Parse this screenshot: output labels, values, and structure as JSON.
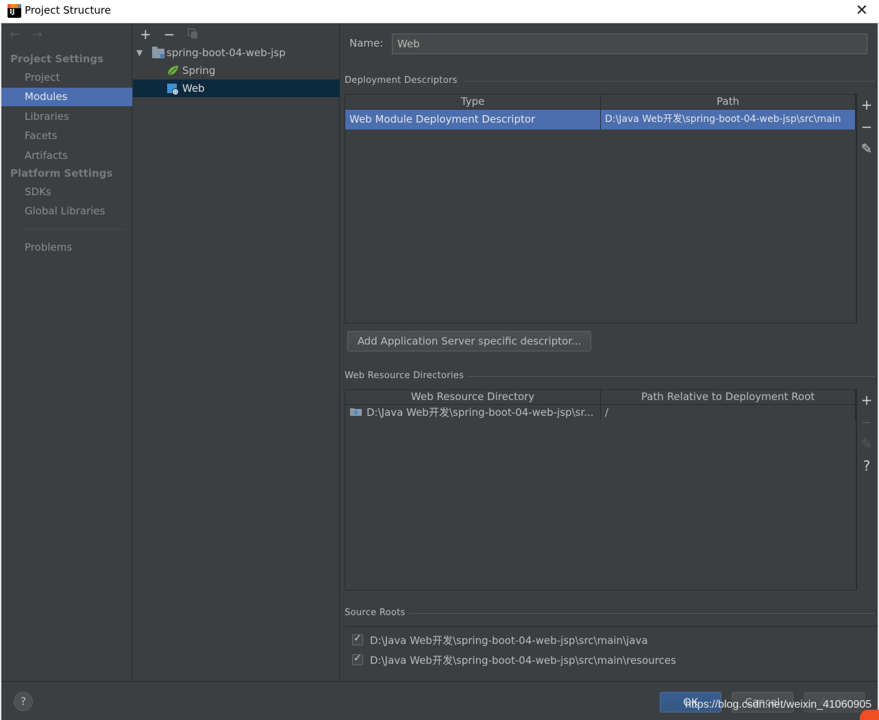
{
  "window": {
    "title": "Project Structure",
    "close_glyph": "✕"
  },
  "sidebar": {
    "nav_back": "←",
    "nav_forward": "→",
    "project_settings_header": "Project Settings",
    "project_items": [
      {
        "label": "Project"
      },
      {
        "label": "Modules",
        "active": true
      },
      {
        "label": "Libraries"
      },
      {
        "label": "Facets"
      },
      {
        "label": "Artifacts"
      }
    ],
    "platform_settings_header": "Platform Settings",
    "platform_items": [
      {
        "label": "SDKs"
      },
      {
        "label": "Global Libraries"
      }
    ],
    "problems_label": "Problems"
  },
  "tree": {
    "toolbar": {
      "add": "+",
      "remove": "−"
    },
    "root": {
      "label": "spring-boot-04-web-jsp",
      "expand_glyph": "▼",
      "icon": "module-folder-icon"
    },
    "children": [
      {
        "label": "Spring",
        "icon": "spring-leaf-icon"
      },
      {
        "label": "Web",
        "icon": "web-facet-icon",
        "selected": true
      }
    ]
  },
  "details": {
    "name_label": "Name:",
    "name_value": "Web",
    "deployment_descriptors": {
      "section_title": "Deployment Descriptors",
      "columns": [
        "Type",
        "Path"
      ],
      "rows": [
        {
          "type": "Web Module Deployment Descriptor",
          "path": "D:\\Java Web开发\\spring-boot-04-web-jsp\\src\\main",
          "selected": true
        }
      ],
      "tools": {
        "add": "+",
        "remove": "−",
        "edit": "✎"
      }
    },
    "add_server_descriptor_button": "Add Application Server specific descriptor...",
    "web_resource_directories": {
      "section_title": "Web Resource Directories",
      "columns": [
        "Web Resource Directory",
        "Path Relative to Deployment Root"
      ],
      "rows": [
        {
          "directory": "D:\\Java Web开发\\spring-boot-04-web-jsp\\sr...",
          "relative_path": "/"
        }
      ],
      "tools": {
        "add": "+",
        "remove": "−",
        "edit": "✎",
        "help": "?"
      }
    },
    "source_roots": {
      "section_title": "Source Roots",
      "items": [
        {
          "path": "D:\\Java Web开发\\spring-boot-04-web-jsp\\src\\main\\java",
          "checked": true
        },
        {
          "path": "D:\\Java Web开发\\spring-boot-04-web-jsp\\src\\main\\resources",
          "checked": true
        }
      ]
    }
  },
  "footer": {
    "help": "?",
    "ok": "OK",
    "cancel": "Cancel",
    "apply": "Apply"
  },
  "watermark": "https://blog.csdn.net/weixin_41060905",
  "colors": {
    "background": "#3c3f41",
    "selection": "#4b6eaf",
    "tree_selection": "#0d293e",
    "primary_button": "#365880"
  }
}
